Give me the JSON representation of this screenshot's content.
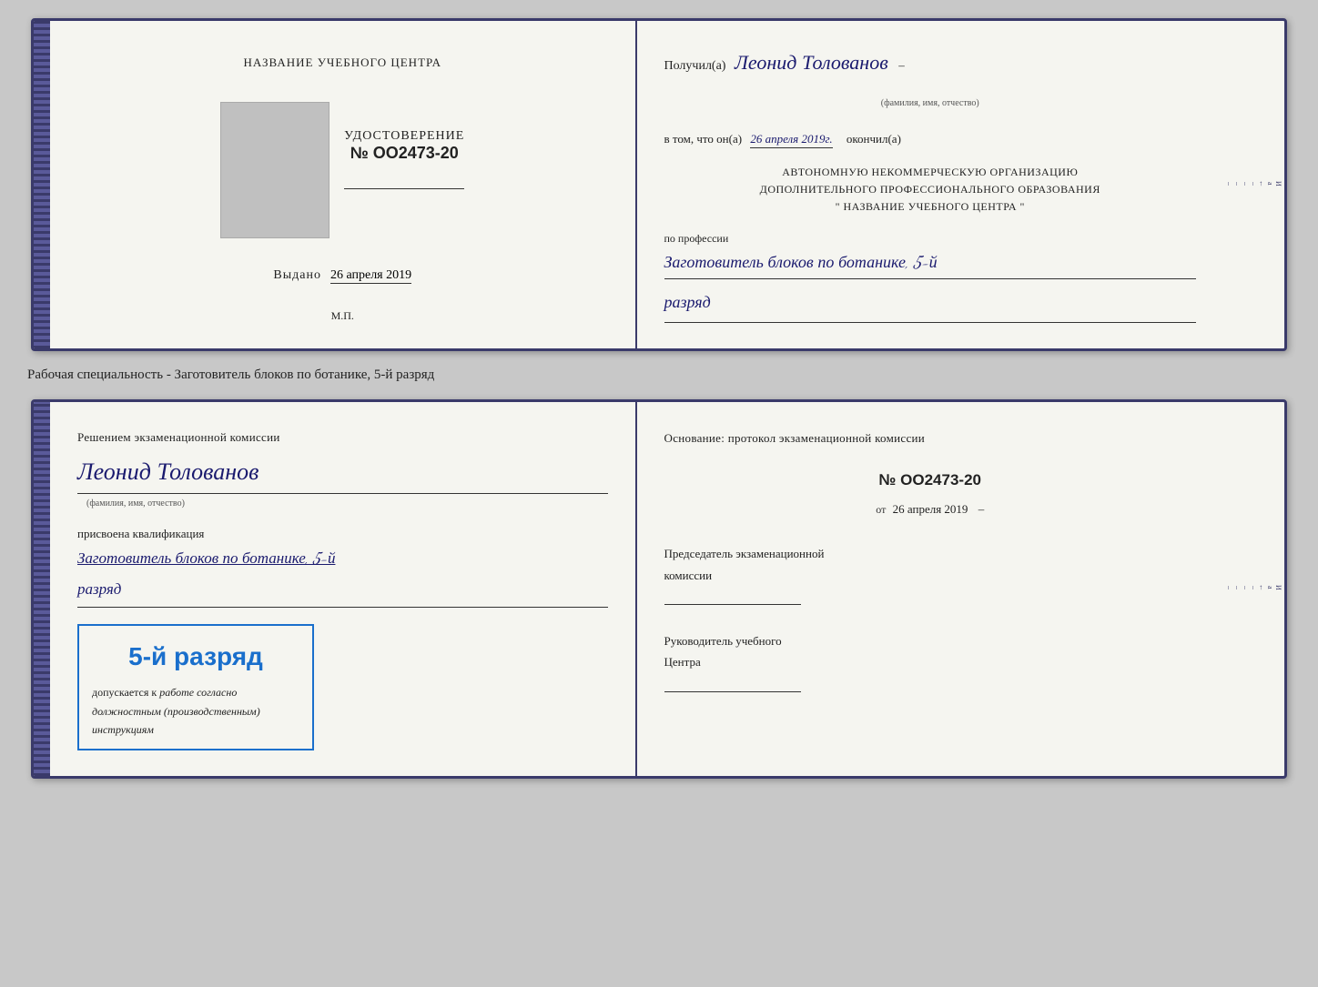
{
  "top_cert": {
    "left": {
      "training_center_label": "НАЗВАНИЕ УЧЕБНОГО ЦЕНТРА",
      "cert_title": "УДОСТОВЕРЕНИЕ",
      "cert_number": "№ OO2473-20",
      "issued_label": "Выдано",
      "issued_date": "26 апреля 2019",
      "mp_label": "М.П."
    },
    "right": {
      "received_label": "Получил(а)",
      "name": "Леонид Толованов",
      "name_sublabel": "(фамилия, имя, отчество)",
      "in_that_label": "в том, что он(а)",
      "date": "26 апреля 2019г.",
      "finished_label": "окончил(а)",
      "org_line1": "АВТОНОМНУЮ НЕКОММЕРЧЕСКУЮ ОРГАНИЗАЦИЮ",
      "org_line2": "ДОПОЛНИТЕЛЬНОГО ПРОФЕССИОНАЛЬНОГО ОБРАЗОВАНИЯ",
      "org_line3": "\"  НАЗВАНИЕ УЧЕБНОГО ЦЕНТРА  \"",
      "profession_label": "по профессии",
      "profession": "Заготовитель блоков по ботанике, 5-й",
      "rank": "разряд",
      "dash": "–"
    }
  },
  "specialty_text": "Рабочая специальность - Заготовитель блоков по ботанике, 5-й разряд",
  "bottom_cert": {
    "left": {
      "decision_text": "Решением экзаменационной комиссии",
      "name": "Леонид Толованов",
      "name_sublabel": "(фамилия, имя, отчество)",
      "qualification_label": "присвоена квалификация",
      "qualification": "Заготовитель блоков по ботанике, 5-й",
      "rank": "разряд",
      "rank_box_title": "5-й разряд",
      "allowed_label": "допускается к",
      "allowed_italic": "работе согласно должностным (производственным) инструкциям"
    },
    "right": {
      "basis_text": "Основание: протокол экзаменационной комиссии",
      "protocol_number": "№ OO2473-20",
      "from_label": "от",
      "from_date": "26 апреля 2019",
      "chairman_line1": "Председатель экзаменационной",
      "chairman_line2": "комиссии",
      "head_line1": "Руководитель учебного",
      "head_line2": "Центра"
    }
  }
}
